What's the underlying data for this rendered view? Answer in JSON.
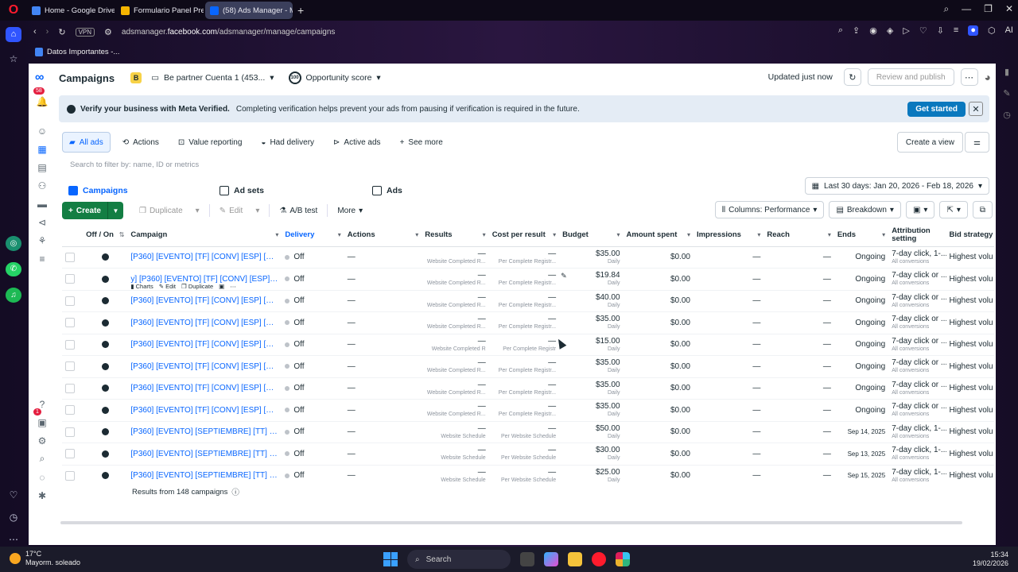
{
  "browser": {
    "tabs": [
      {
        "label": "Home - Google Drive",
        "color": "#4285f4"
      },
      {
        "label": "Formulario Panel Premium",
        "color": "#f4b400"
      },
      {
        "label": "(58) Ads Manager - Mana",
        "color": "#0866ff",
        "active": true
      }
    ],
    "vpn": "VPN",
    "url_prefix": "adsmanager.",
    "url_domain": "facebook.com",
    "url_path": "/adsmanager/manage/campaigns",
    "bookmark": "Datos Importantes -...",
    "ai_label": "AI"
  },
  "header": {
    "title": "Campaigns",
    "account_badge": "B",
    "account": "Be partner Cuenta 1 (453...",
    "opportunity_value": "100",
    "opportunity": "Opportunity score",
    "updated": "Updated just now",
    "review": "Review and publish",
    "notifications": "58"
  },
  "banner": {
    "bold": "Verify your business with Meta Verified.",
    "text": "Completing verification helps prevent your ads from pausing if verification is required in the future.",
    "cta": "Get started"
  },
  "views": {
    "items": [
      "All ads",
      "Actions",
      "Value reporting",
      "Had delivery",
      "Active ads"
    ],
    "see_more": "See more",
    "create_view": "Create a view"
  },
  "search": {
    "placeholder": "Search to filter by: name, ID or metrics"
  },
  "levels": {
    "campaigns": "Campaigns",
    "adsets": "Ad sets",
    "ads": "Ads"
  },
  "daterange": "Last 30 days: Jan 20, 2026 - Feb 18, 2026",
  "toolbar": {
    "create": "Create",
    "duplicate": "Duplicate",
    "edit": "Edit",
    "abtest": "A/B test",
    "more": "More",
    "columns": "Columns: Performance",
    "breakdown": "Breakdown"
  },
  "columns": [
    "Off / On",
    "Campaign",
    "Delivery",
    "Actions",
    "Results",
    "Cost per result",
    "Budget",
    "Amount spent",
    "Impressions",
    "Reach",
    "Ends",
    "Attribution setting",
    "Bid strategy"
  ],
  "row_actions": {
    "charts": "Charts",
    "edit": "Edit",
    "duplicate": "Duplicate"
  },
  "rows": [
    {
      "name": "[P360] [EVENTO] [TF] [CONV] [ESP] [ADS S...",
      "delivery": "Off",
      "actions": "—",
      "results": "—",
      "results_sub": "Website Completed R...",
      "cpr": "—",
      "cpr_sub": "Per Complete Registr...",
      "budget": "$35.00",
      "budget_sub": "Daily",
      "spent": "$0.00",
      "impr": "—",
      "reach": "—",
      "ends": "Ongoing",
      "attr": "7-day click, 1-...",
      "attr_sub": "All conversions",
      "bid": "Highest volu"
    },
    {
      "name": "y] [P360] [EVENTO] [TF] [CONV] [ESP] [A...",
      "delivery": "Off",
      "actions": "—",
      "results": "—",
      "results_sub": "Website Completed R...",
      "cpr": "—",
      "cpr_sub": "Per Complete Registr...",
      "budget": "$19.84",
      "budget_sub": "Daily",
      "spent": "$0.00",
      "impr": "—",
      "reach": "—",
      "ends": "Ongoing",
      "attr": "7-day click or ...",
      "attr_sub": "All conversions",
      "bid": "Highest volu",
      "hover": true
    },
    {
      "name": "[P360] [EVENTO] [TF] [CONV] [ESP] [ADS S...",
      "delivery": "Off",
      "actions": "—",
      "results": "—",
      "results_sub": "Website Completed R...",
      "cpr": "—",
      "cpr_sub": "Per Complete Registr...",
      "budget": "$40.00",
      "budget_sub": "Daily",
      "spent": "$0.00",
      "impr": "—",
      "reach": "—",
      "ends": "Ongoing",
      "attr": "7-day click or ...",
      "attr_sub": "All conversions",
      "bid": "Highest volu"
    },
    {
      "name": "[P360] [EVENTO] [TF] [CONV] [ESP] [ADS S...",
      "delivery": "Off",
      "actions": "—",
      "results": "—",
      "results_sub": "Website Completed R...",
      "cpr": "—",
      "cpr_sub": "Per Complete Registr...",
      "budget": "$35.00",
      "budget_sub": "Daily",
      "spent": "$0.00",
      "impr": "—",
      "reach": "—",
      "ends": "Ongoing",
      "attr": "7-day click or ...",
      "attr_sub": "All conversions",
      "bid": "Highest volu"
    },
    {
      "name": "[P360] [EVENTO] [TF] [CONV] [ESP] [ADS S...",
      "delivery": "Off",
      "actions": "—",
      "results": "—",
      "results_sub": "Website Completed R",
      "cpr": "—",
      "cpr_sub": "Per Complete Registr",
      "budget": "$15.00",
      "budget_sub": "Daily",
      "spent": "$0.00",
      "impr": "—",
      "reach": "—",
      "ends": "Ongoing",
      "attr": "7-day click or ...",
      "attr_sub": "All conversions",
      "bid": "Highest volu"
    },
    {
      "name": "[P360] [EVENTO] [TF] [CONV] [ESP] [ADS S...",
      "delivery": "Off",
      "actions": "—",
      "results": "—",
      "results_sub": "Website Completed R...",
      "cpr": "—",
      "cpr_sub": "Per Complete Registr...",
      "budget": "$35.00",
      "budget_sub": "Daily",
      "spent": "$0.00",
      "impr": "—",
      "reach": "—",
      "ends": "Ongoing",
      "attr": "7-day click or ...",
      "attr_sub": "All conversions",
      "bid": "Highest volu"
    },
    {
      "name": "[P360] [EVENTO] [TF] [CONV] [ESP] [ADS S...",
      "delivery": "Off",
      "actions": "—",
      "results": "—",
      "results_sub": "Website Completed R...",
      "cpr": "—",
      "cpr_sub": "Per Complete Registr...",
      "budget": "$35.00",
      "budget_sub": "Daily",
      "spent": "$0.00",
      "impr": "—",
      "reach": "—",
      "ends": "Ongoing",
      "attr": "7-day click or ...",
      "attr_sub": "All conversions",
      "bid": "Highest volu"
    },
    {
      "name": "[P360] [EVENTO] [TF] [CONV] [ESP] [ADS S...",
      "delivery": "Off",
      "actions": "—",
      "results": "—",
      "results_sub": "Website Completed R...",
      "cpr": "—",
      "cpr_sub": "Per Complete Registr...",
      "budget": "$35.00",
      "budget_sub": "Daily",
      "spent": "$0.00",
      "impr": "—",
      "reach": "—",
      "ends": "Ongoing",
      "attr": "7-day click or ...",
      "attr_sub": "All conversions",
      "bid": "Highest volu"
    },
    {
      "name": "[P360] [EVENTO] [SEPTIEMBRE] [TT] [CON...",
      "delivery": "Off",
      "actions": "—",
      "results": "—",
      "results_sub": "Website Schedule",
      "cpr": "—",
      "cpr_sub": "Per Website Schedule",
      "budget": "$50.00",
      "budget_sub": "Daily",
      "spent": "$0.00",
      "impr": "—",
      "reach": "—",
      "ends": "Sep 14, 2025",
      "attr": "7-day click, 1-...",
      "attr_sub": "All conversions",
      "bid": "Highest volu"
    },
    {
      "name": "[P360] [EVENTO] [SEPTIEMBRE] [TT] [CON...",
      "delivery": "Off",
      "actions": "—",
      "results": "—",
      "results_sub": "Website Schedule",
      "cpr": "—",
      "cpr_sub": "Per Website Schedule",
      "budget": "$30.00",
      "budget_sub": "Daily",
      "spent": "$0.00",
      "impr": "—",
      "reach": "—",
      "ends": "Sep 13, 2025",
      "attr": "7-day click, 1-...",
      "attr_sub": "All conversions",
      "bid": "Highest volu"
    },
    {
      "name": "[P360] [EVENTO] [SEPTIEMBRE] [TT] [CON...",
      "delivery": "Off",
      "actions": "—",
      "results": "—",
      "results_sub": "Website Schedule",
      "cpr": "—",
      "cpr_sub": "Per Website Schedule",
      "budget": "$25.00",
      "budget_sub": "Daily",
      "spent": "$0.00",
      "impr": "—",
      "reach": "—",
      "ends": "Sep 15, 2025",
      "attr": "7-day click, 1-...",
      "attr_sub": "All conversions",
      "bid": "Highest volu"
    }
  ],
  "results_from": "Results from 148 campaigns",
  "taskbar": {
    "temp": "17°C",
    "weather": "Mayorm. soleado",
    "search": "Search",
    "time": "15:34",
    "date": "19/02/2026"
  },
  "colors": {
    "accent": "#0866ff",
    "create": "#137e43",
    "banner_cta": "#0a78be"
  }
}
